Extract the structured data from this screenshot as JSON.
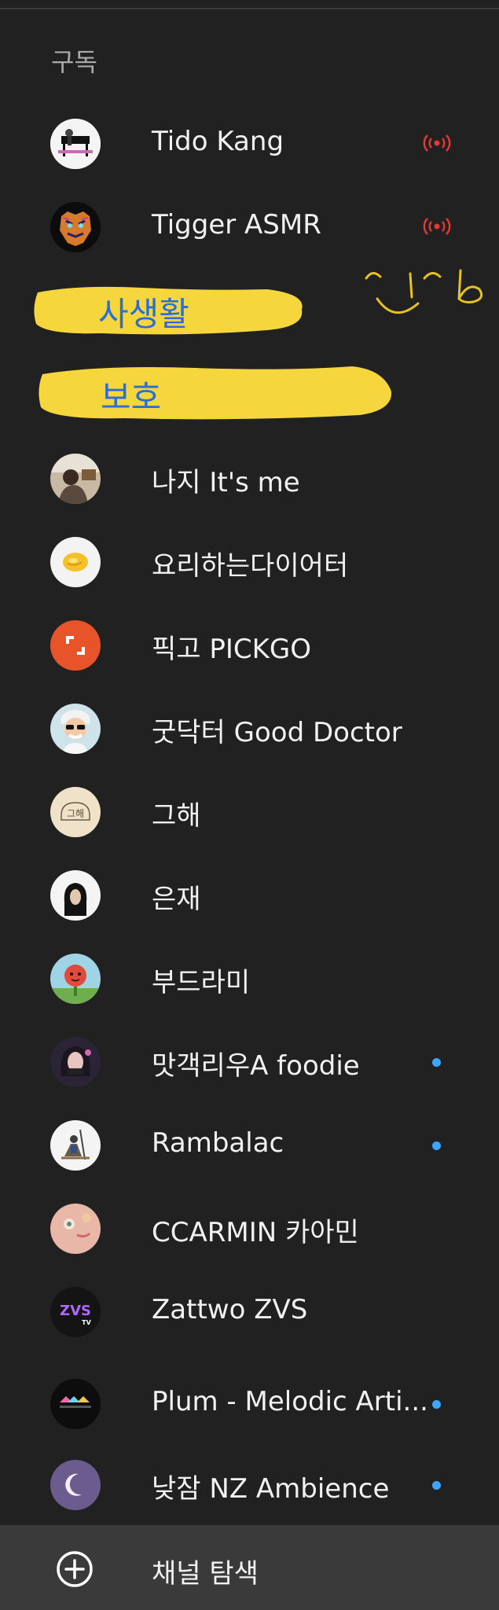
{
  "section_title": "구독",
  "live_channels": [
    {
      "name": "Tido Kang",
      "icon": "piano-avatar",
      "status": "live"
    },
    {
      "name": "Tigger ASMR",
      "icon": "tiger-avatar",
      "status": "live"
    }
  ],
  "annotations": {
    "highlight_1": "사생활",
    "highlight_2": "보호",
    "doodle": "^!^b"
  },
  "channels": [
    {
      "name": "나지 It's me",
      "icon": "person-avatar",
      "new": false
    },
    {
      "name": "요리하는다이어터",
      "icon": "egg-avatar",
      "new": false
    },
    {
      "name": "픽고 PICKGO",
      "icon": "pickgo-logo-avatar",
      "new": false
    },
    {
      "name": "굿닥터 Good Doctor",
      "icon": "doctor-cartoon-avatar",
      "new": false
    },
    {
      "name": "그해",
      "icon": "geuhae-logo-avatar",
      "new": false
    },
    {
      "name": "은재",
      "icon": "person-avatar",
      "new": false
    },
    {
      "name": "부드라미",
      "icon": "flower-cartoon-avatar",
      "new": false
    },
    {
      "name": "맛객리우A foodie",
      "icon": "person-avatar",
      "new": true
    },
    {
      "name": "Rambalac",
      "icon": "knight-avatar",
      "new": true
    },
    {
      "name": "CCARMIN 카아민",
      "icon": "face-avatar",
      "new": false
    },
    {
      "name": "Zattwo ZVS",
      "icon": "zvs-logo-avatar",
      "new": false
    },
    {
      "name": "Plum - Melodic Arti...",
      "icon": "plum-logo-avatar",
      "new": true
    },
    {
      "name": "낮잠 NZ Ambience",
      "icon": "moon-avatar",
      "new": true
    }
  ],
  "explore": {
    "label": "채널 탐색",
    "icon": "plus-circle-icon"
  },
  "colors": {
    "background": "#212121",
    "live_red": "#e53935",
    "new_dot": "#3ea6ff",
    "highlight_yellow": "#f5d63c",
    "annotation_blue": "#2a6fd6"
  }
}
